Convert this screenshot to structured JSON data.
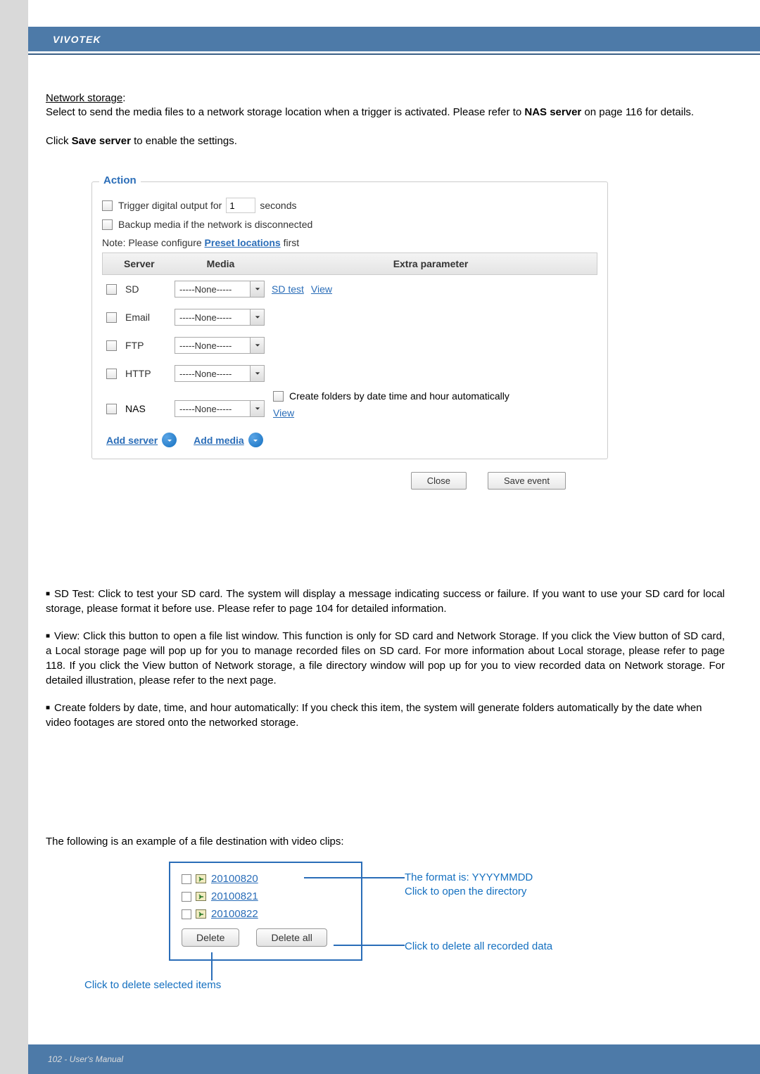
{
  "header": {
    "brand": "VIVOTEK"
  },
  "intro": {
    "ns_label": "Network storage",
    "ns_sentence_after": ":",
    "paragraph": "Select to send the media files to a network storage location when a trigger is activated. Please refer to ",
    "nas_bold": "NAS server",
    "paragraph_after_nas": " on page 116 for details.",
    "click": "Click ",
    "save_server_bold": "Save server",
    "click_after": " to enable the settings."
  },
  "panel": {
    "legend": "Action",
    "trigger_label": "Trigger digital output for",
    "trigger_value": "1",
    "trigger_unit": "seconds",
    "backup_label": "Backup media if the network is disconnected",
    "note_prefix": "Note: Please configure ",
    "note_link": "Preset locations",
    "note_suffix": " first",
    "th_server": "Server",
    "th_media": "Media",
    "th_extra": "Extra parameter",
    "none_option": "-----None-----",
    "servers": {
      "sd": "SD",
      "email": "Email",
      "ftp": "FTP",
      "http": "HTTP",
      "nas": "NAS"
    },
    "sd_test": "SD test",
    "view": "View",
    "nas_create": "Create folders by date time and hour automatically",
    "add_server": "Add server",
    "add_media": "Add media",
    "close_btn": "Close",
    "save_event_btn": "Save event"
  },
  "bullets": {
    "b1": "SD Test: Click to test your SD card. The system will display a message indicating success or failure. If you want to use your SD card for local storage, please format it before use. Please refer to page 104 for detailed information.",
    "b2": "View: Click this button to open a file list window. This function is only for SD card and Network Storage. If you click the View button of SD card, a Local storage page will pop up for you to manage recorded files on SD card. For more information about Local storage, please refer to page 118. If you click the View button of Network storage, a file directory window will pop up for you to view recorded data on Network storage. For detailed illustration, please refer to the next page.",
    "b3": "Create folders by date, time, and hour automatically: If you check this item, the system will generate folders automatically by the date when video footages are stored onto the networked storage."
  },
  "example_text": "The following is an example of a file destination with video clips:",
  "folders": {
    "f1": "20100820",
    "f2": "20100821",
    "f3": "20100822",
    "delete_btn": "Delete",
    "delete_all_btn": "Delete all"
  },
  "annotations": {
    "format_line1": "The format is: YYYYMMDD",
    "format_line2": "Click to open the directory",
    "delete_all": "Click to delete all recorded data",
    "delete_sel": "Click to delete selected items"
  },
  "footer": {
    "text": "102 - User's Manual"
  }
}
